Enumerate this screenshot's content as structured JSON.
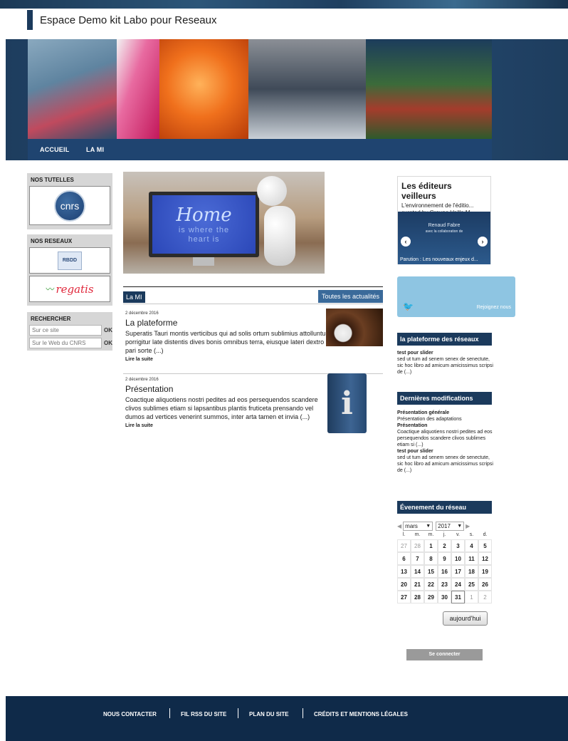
{
  "site": {
    "title": "Espace Demo kit Labo pour Reseaux"
  },
  "nav": {
    "items": [
      "ACCUEIL",
      "LA MI"
    ]
  },
  "left": {
    "tutelles_title": "NOS TUTELLES",
    "cnrs_logo_text": "cnrs",
    "reseaux_title": "NOS RESEAUX",
    "rbdd_text": "RBDD",
    "regatis_text": "regatis",
    "search_title": "RECHERCHER",
    "search_site_placeholder": "Sur ce site",
    "search_cnrs_placeholder": "Sur le Web du CNRS",
    "ok_label": "OK"
  },
  "hero": {
    "big_text": "Home",
    "small_text_1": "is where the",
    "small_text_2": "heart is"
  },
  "news": {
    "tab_label": "La MI",
    "all_label": "Toutes les actualités",
    "items": [
      {
        "date": "2 décembre 2016",
        "title": "La plateforme",
        "text": "Superatis Tauri montis verticibus qui ad solis ortum sublimius attolluntur, Cilicia spatiis porrigitur late distentis dives bonis omnibus terra, eiusque lateri dextro adnexa Isauria, pari sorte (...)",
        "more": "Lire la suite"
      },
      {
        "date": "2 décembre 2016",
        "title": "Présentation",
        "text": "Coactique aliquotiens nostri pedites ad eos persequendos scandere clivos sublimes etiam si lapsantibus plantis fruticeta prensando vel dumos ad vertices venerint summos, inter arta tamen et invia (...)",
        "more": "Lire la suite"
      }
    ]
  },
  "editeurs": {
    "title": "Les éditeurs veilleurs",
    "subtitle_1": "L'environnement de l'éditio...",
    "subtitle_2": "curated by Groupe Veille M...",
    "slide_line_1": "Renaud Fabre",
    "slide_line_2": "avec la collaboration de",
    "caption": "Parution : Les nouveaux enjeux d..."
  },
  "twitter": {
    "join": "Rejoignez nous"
  },
  "plateforme": {
    "title": "la plateforme des réseaux",
    "item_title": "test pour slider",
    "item_text": "sed ut tum ad senem senex de senectute, sic hoc libro ad amicum amicissimus scripsi de (...)"
  },
  "modifs": {
    "title": "Dernières modifications",
    "items": [
      {
        "title": "Présentation générale",
        "text": "Présentation des adaptations"
      },
      {
        "title": "Présentation",
        "text": "Coactique aliquotiens nostri pedites ad eos persequendos scandere clivos sublimes etiam si (...)"
      },
      {
        "title": "test pour slider",
        "text": "sed ut tum ad senem senex de senectute, sic hoc libro ad amicum amicissimus scripsi de (...)"
      }
    ]
  },
  "calendar": {
    "title": "Évenement du réseau",
    "month": "mars",
    "year": "2017",
    "weekdays": [
      "l.",
      "m.",
      "m.",
      "j.",
      "v.",
      "s.",
      "d."
    ],
    "today_label": "aujourd'hui"
  },
  "login": {
    "label": "Se connecter"
  },
  "footer": {
    "items": [
      "NOUS CONTACTER",
      "FIL RSS DU SITE",
      "PLAN DU SITE",
      "CRÉDITS ET MENTIONS LÉGALES"
    ]
  },
  "colors": {
    "navy": "#1b3a5c",
    "footer": "#0f2a49",
    "twitter": "#8ec5e2"
  }
}
